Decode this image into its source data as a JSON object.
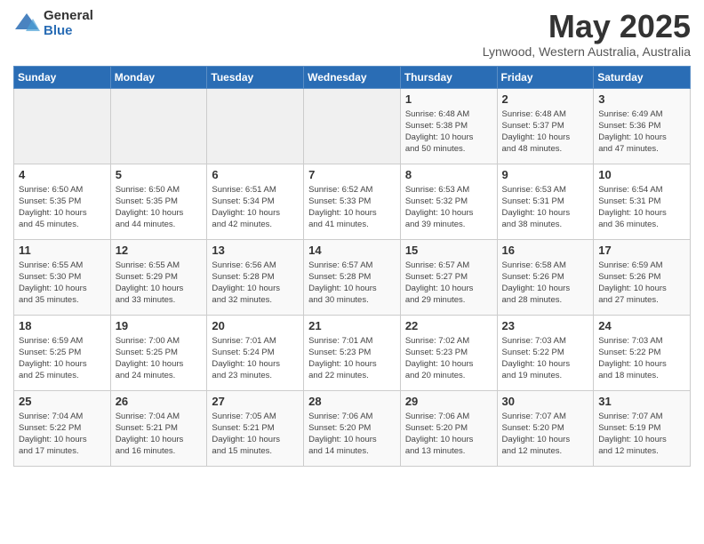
{
  "logo": {
    "general": "General",
    "blue": "Blue"
  },
  "header": {
    "title": "May 2025",
    "location": "Lynwood, Western Australia, Australia"
  },
  "days_of_week": [
    "Sunday",
    "Monday",
    "Tuesday",
    "Wednesday",
    "Thursday",
    "Friday",
    "Saturday"
  ],
  "weeks": [
    [
      {
        "day": "",
        "info": ""
      },
      {
        "day": "",
        "info": ""
      },
      {
        "day": "",
        "info": ""
      },
      {
        "day": "",
        "info": ""
      },
      {
        "day": "1",
        "info": "Sunrise: 6:48 AM\nSunset: 5:38 PM\nDaylight: 10 hours\nand 50 minutes."
      },
      {
        "day": "2",
        "info": "Sunrise: 6:48 AM\nSunset: 5:37 PM\nDaylight: 10 hours\nand 48 minutes."
      },
      {
        "day": "3",
        "info": "Sunrise: 6:49 AM\nSunset: 5:36 PM\nDaylight: 10 hours\nand 47 minutes."
      }
    ],
    [
      {
        "day": "4",
        "info": "Sunrise: 6:50 AM\nSunset: 5:35 PM\nDaylight: 10 hours\nand 45 minutes."
      },
      {
        "day": "5",
        "info": "Sunrise: 6:50 AM\nSunset: 5:35 PM\nDaylight: 10 hours\nand 44 minutes."
      },
      {
        "day": "6",
        "info": "Sunrise: 6:51 AM\nSunset: 5:34 PM\nDaylight: 10 hours\nand 42 minutes."
      },
      {
        "day": "7",
        "info": "Sunrise: 6:52 AM\nSunset: 5:33 PM\nDaylight: 10 hours\nand 41 minutes."
      },
      {
        "day": "8",
        "info": "Sunrise: 6:53 AM\nSunset: 5:32 PM\nDaylight: 10 hours\nand 39 minutes."
      },
      {
        "day": "9",
        "info": "Sunrise: 6:53 AM\nSunset: 5:31 PM\nDaylight: 10 hours\nand 38 minutes."
      },
      {
        "day": "10",
        "info": "Sunrise: 6:54 AM\nSunset: 5:31 PM\nDaylight: 10 hours\nand 36 minutes."
      }
    ],
    [
      {
        "day": "11",
        "info": "Sunrise: 6:55 AM\nSunset: 5:30 PM\nDaylight: 10 hours\nand 35 minutes."
      },
      {
        "day": "12",
        "info": "Sunrise: 6:55 AM\nSunset: 5:29 PM\nDaylight: 10 hours\nand 33 minutes."
      },
      {
        "day": "13",
        "info": "Sunrise: 6:56 AM\nSunset: 5:28 PM\nDaylight: 10 hours\nand 32 minutes."
      },
      {
        "day": "14",
        "info": "Sunrise: 6:57 AM\nSunset: 5:28 PM\nDaylight: 10 hours\nand 30 minutes."
      },
      {
        "day": "15",
        "info": "Sunrise: 6:57 AM\nSunset: 5:27 PM\nDaylight: 10 hours\nand 29 minutes."
      },
      {
        "day": "16",
        "info": "Sunrise: 6:58 AM\nSunset: 5:26 PM\nDaylight: 10 hours\nand 28 minutes."
      },
      {
        "day": "17",
        "info": "Sunrise: 6:59 AM\nSunset: 5:26 PM\nDaylight: 10 hours\nand 27 minutes."
      }
    ],
    [
      {
        "day": "18",
        "info": "Sunrise: 6:59 AM\nSunset: 5:25 PM\nDaylight: 10 hours\nand 25 minutes."
      },
      {
        "day": "19",
        "info": "Sunrise: 7:00 AM\nSunset: 5:25 PM\nDaylight: 10 hours\nand 24 minutes."
      },
      {
        "day": "20",
        "info": "Sunrise: 7:01 AM\nSunset: 5:24 PM\nDaylight: 10 hours\nand 23 minutes."
      },
      {
        "day": "21",
        "info": "Sunrise: 7:01 AM\nSunset: 5:23 PM\nDaylight: 10 hours\nand 22 minutes."
      },
      {
        "day": "22",
        "info": "Sunrise: 7:02 AM\nSunset: 5:23 PM\nDaylight: 10 hours\nand 20 minutes."
      },
      {
        "day": "23",
        "info": "Sunrise: 7:03 AM\nSunset: 5:22 PM\nDaylight: 10 hours\nand 19 minutes."
      },
      {
        "day": "24",
        "info": "Sunrise: 7:03 AM\nSunset: 5:22 PM\nDaylight: 10 hours\nand 18 minutes."
      }
    ],
    [
      {
        "day": "25",
        "info": "Sunrise: 7:04 AM\nSunset: 5:22 PM\nDaylight: 10 hours\nand 17 minutes."
      },
      {
        "day": "26",
        "info": "Sunrise: 7:04 AM\nSunset: 5:21 PM\nDaylight: 10 hours\nand 16 minutes."
      },
      {
        "day": "27",
        "info": "Sunrise: 7:05 AM\nSunset: 5:21 PM\nDaylight: 10 hours\nand 15 minutes."
      },
      {
        "day": "28",
        "info": "Sunrise: 7:06 AM\nSunset: 5:20 PM\nDaylight: 10 hours\nand 14 minutes."
      },
      {
        "day": "29",
        "info": "Sunrise: 7:06 AM\nSunset: 5:20 PM\nDaylight: 10 hours\nand 13 minutes."
      },
      {
        "day": "30",
        "info": "Sunrise: 7:07 AM\nSunset: 5:20 PM\nDaylight: 10 hours\nand 12 minutes."
      },
      {
        "day": "31",
        "info": "Sunrise: 7:07 AM\nSunset: 5:19 PM\nDaylight: 10 hours\nand 12 minutes."
      }
    ]
  ]
}
